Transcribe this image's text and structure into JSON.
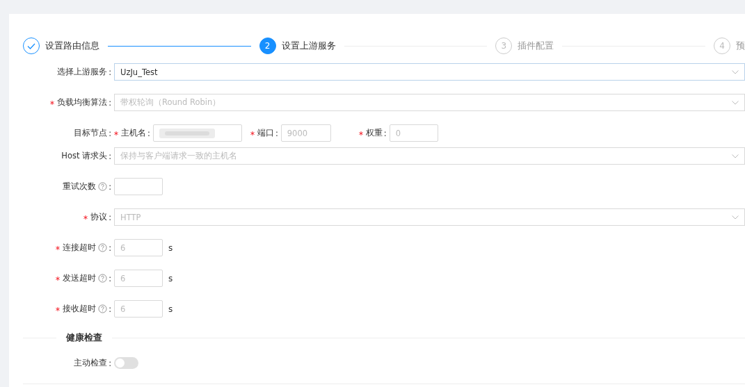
{
  "steps": [
    {
      "title": "设置路由信息",
      "finished": true,
      "selected": false
    },
    {
      "number": "2",
      "title": "设置上游服务",
      "finished": false,
      "selected": true
    },
    {
      "number": "3",
      "title": "插件配置",
      "finished": false,
      "selected": false
    },
    {
      "number": "4",
      "title": "预",
      "finished": false,
      "selected": false
    }
  ],
  "form": [
    {
      "kind": "select",
      "label": "选择上游服务",
      "colon": ":",
      "required": false,
      "value": "UzJu_Test",
      "hovered": true
    },
    {
      "kind": "select",
      "label": "负载均衡算法",
      "colon": ":",
      "required": true,
      "placeholder": "带权轮询（Round Robin）"
    },
    {
      "kind": "node",
      "label": "目标节点",
      "colon": ":",
      "parts": [
        {
          "label": "主机名",
          "colon": ":",
          "required": true,
          "redacted": true
        },
        {
          "label": "端口",
          "colon": ":",
          "required": true,
          "placeholder": "9000"
        },
        {
          "label": "权重",
          "colon": ":",
          "required": true,
          "placeholder": "0"
        }
      ]
    },
    {
      "kind": "select",
      "label": "Host 请求头",
      "colon": ":",
      "required": false,
      "placeholder": "保持与客户端请求一致的主机名"
    },
    {
      "kind": "number",
      "label": "重试次数",
      "colon": ":",
      "required": false,
      "help": true
    },
    {
      "kind": "select",
      "label": "协议",
      "colon": ":",
      "required": true,
      "placeholder": "HTTP"
    },
    {
      "kind": "number",
      "label": "连接超时",
      "colon": ":",
      "required": true,
      "help": true,
      "placeholder": "6",
      "suffix": "s"
    },
    {
      "kind": "number",
      "label": "发送超时",
      "colon": ":",
      "required": true,
      "help": true,
      "placeholder": "6",
      "suffix": "s"
    },
    {
      "kind": "number",
      "label": "接收超时",
      "colon": ":",
      "required": true,
      "help": true,
      "placeholder": "6",
      "suffix": "s"
    },
    {
      "kind": "section",
      "title": "健康检查"
    },
    {
      "kind": "toggle",
      "label": "主动检查",
      "colon": ":",
      "on": false
    }
  ]
}
